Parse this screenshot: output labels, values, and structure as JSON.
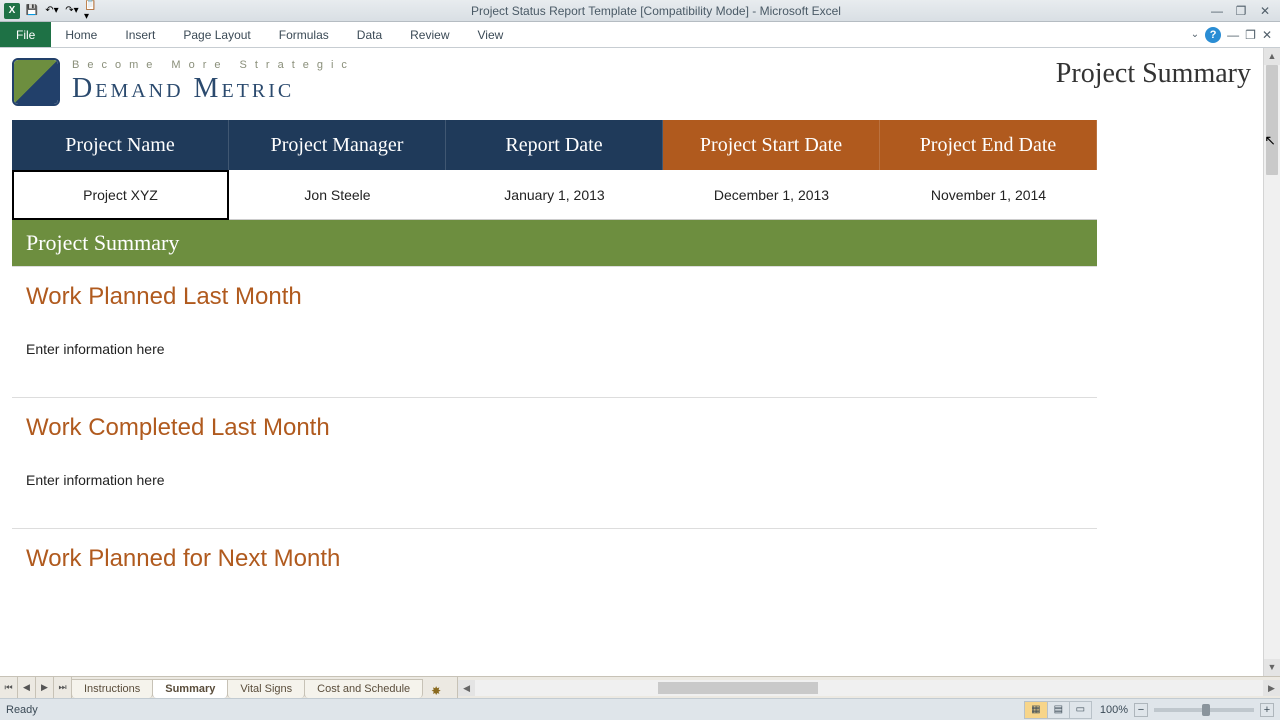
{
  "app": {
    "title": "Project Status Report Template  [Compatibility Mode]  -  Microsoft Excel"
  },
  "ribbon": {
    "tabs": [
      "File",
      "Home",
      "Insert",
      "Page Layout",
      "Formulas",
      "Data",
      "Review",
      "View"
    ]
  },
  "logo": {
    "tagline": "Become More Strategic",
    "brand": "Demand Metric"
  },
  "page_title": "Project Summary",
  "info": {
    "headers": [
      "Project Name",
      "Project Manager",
      "Report Date",
      "Project Start Date",
      "Project End Date"
    ],
    "values": [
      "Project XYZ",
      "Jon Steele",
      "January 1, 2013",
      "December 1, 2013",
      "November 1, 2014"
    ]
  },
  "section_band": "Project Summary",
  "sections": [
    {
      "title": "Work Planned Last Month",
      "body": "Enter information here"
    },
    {
      "title": "Work Completed Last Month",
      "body": "Enter information here"
    },
    {
      "title": "Work Planned for Next Month",
      "body": ""
    }
  ],
  "sheets": {
    "tabs": [
      "Instructions",
      "Summary",
      "Vital Signs",
      "Cost and Schedule"
    ],
    "active": "Summary"
  },
  "status": {
    "ready": "Ready",
    "zoom": "100%"
  }
}
